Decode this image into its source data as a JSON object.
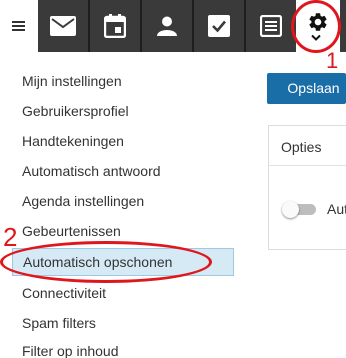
{
  "toolbar": {
    "tabs": [
      {
        "icon": "mail-icon"
      },
      {
        "icon": "calendar-icon"
      },
      {
        "icon": "contacts-icon"
      },
      {
        "icon": "tasks-icon"
      },
      {
        "icon": "notes-icon"
      },
      {
        "icon": "settings-gear-icon",
        "selected": true
      }
    ],
    "tab_color": "#3a3a3a"
  },
  "annotations": {
    "marker_1": "1",
    "marker_2": "2",
    "color": "#e0161d"
  },
  "sidebar": {
    "items": [
      {
        "label": "Mijn instellingen"
      },
      {
        "label": "Gebruikersprofiel"
      },
      {
        "label": "Handtekeningen"
      },
      {
        "label": "Automatisch antwoord"
      },
      {
        "label": "Agenda instellingen"
      },
      {
        "label": "Gebeurtenissen"
      },
      {
        "label": "Automatisch opschonen",
        "active": true
      },
      {
        "label": "Connectiviteit"
      },
      {
        "label": "Spam filters"
      },
      {
        "label": "Filter op inhoud"
      }
    ]
  },
  "main": {
    "save_label": "Opslaan",
    "save_color": "#1a6ea8",
    "panel_title": "Opties",
    "toggle_label": "Aut",
    "toggle_on": false
  }
}
